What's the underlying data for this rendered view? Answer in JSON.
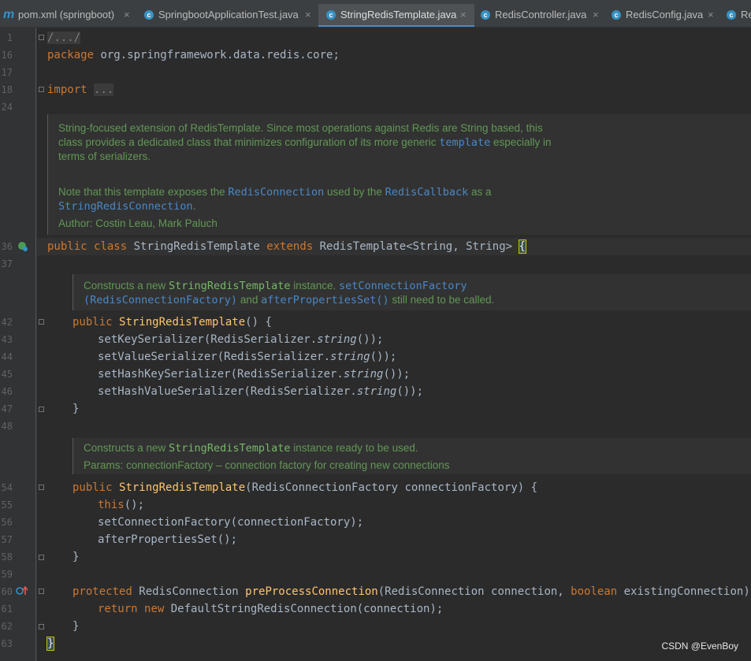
{
  "tabs": [
    {
      "label": "pom.xml (springboot)",
      "icon": "m-maven-icon",
      "active": false
    },
    {
      "label": "SpringbootApplicationTest.java",
      "icon": "class-icon",
      "active": false
    },
    {
      "label": "StringRedisTemplate.java",
      "icon": "class-icon",
      "active": true
    },
    {
      "label": "RedisController.java",
      "icon": "class-icon",
      "active": false
    },
    {
      "label": "RedisConfig.java",
      "icon": "class-icon",
      "active": false
    },
    {
      "label": "Re",
      "icon": "class-icon",
      "active": false
    }
  ],
  "tab_close_glyph": "×",
  "line_numbers": [
    "1",
    "16",
    "17",
    "18",
    "24",
    "36",
    "37",
    "42",
    "43",
    "44",
    "45",
    "46",
    "47",
    "48",
    "54",
    "55",
    "56",
    "57",
    "58",
    "59",
    "60",
    "61",
    "62",
    "63"
  ],
  "code": {
    "l1": "/.../",
    "package_kw": "package",
    "package_name": " org.springframework.data.redis.core;",
    "import_kw": "import",
    "import_fold": "...",
    "class_public": "public",
    "class_class": "class",
    "class_name": " StringRedisTemplate ",
    "class_extends": "extends",
    "class_super": " RedisTemplate<String, String> ",
    "brace_open": "{",
    "ctor1_public": "public",
    "ctor1_name": "StringRedisTemplate",
    "ctor1_rest": "() {",
    "set_key": "setKeySerializer(RedisSerializer.",
    "set_value": "setValueSerializer(RedisSerializer.",
    "set_hash_key": "setHashKeySerializer(RedisSerializer.",
    "set_hash_value": "setHashValueSerializer(RedisSerializer.",
    "string_call": "string",
    "call_end": "());",
    "close_brace": "}",
    "ctor2_public": "public",
    "ctor2_name": "StringRedisTemplate",
    "ctor2_rest": "(RedisConnectionFactory connectionFactory) {",
    "this_call": "this",
    "this_end": "();",
    "set_conn_factory": "setConnectionFactory(connectionFactory);",
    "after_props": "afterPropertiesSet();",
    "pre_protected": "protected",
    "pre_type": " RedisConnection ",
    "pre_name": "preProcessConnection",
    "pre_args1": "(RedisConnection connection, ",
    "pre_boolean": "boolean",
    "pre_args2": " existingConnection) {",
    "ret_return": "return",
    "ret_new": "new",
    "ret_rest": " DefaultStringRedisConnection(connection);",
    "final_brace": "}"
  },
  "docs": {
    "class_doc": {
      "p1_l1": "String-focused extension of RedisTemplate. Since most operations against Redis are String based, this",
      "p1_l2a": "class provides a dedicated class that minimizes configuration of its more generic ",
      "p1_l2_ref": "template",
      "p1_l2b": " especially in",
      "p1_l3": "terms of serializers.",
      "p2_l1a": "Note that this template exposes the ",
      "p2_ref1": "RedisConnection",
      "p2_l1b": " used by the ",
      "p2_ref2": "RedisCallback",
      "p2_l1c": " as a",
      "p2_ref3": "StringRedisConnection",
      "p2_l2_end": ".",
      "author": "Author: Costin Leau, Mark Paluch"
    },
    "ctor1_doc": {
      "l1a": "Constructs a new ",
      "l1_code": "StringRedisTemplate",
      "l1b": " instance. ",
      "l1_ref": "setConnectionFactory",
      "l2_ref": "(RedisConnectionFactory)",
      "l2a": " and ",
      "l2_ref2": "afterPropertiesSet()",
      "l2b": " still need to be called."
    },
    "ctor2_doc": {
      "l1a": "Constructs a new ",
      "l1_code": "StringRedisTemplate",
      "l1b": " instance ready to be used.",
      "l2": "Params: connectionFactory – connection factory for creating new connections"
    }
  },
  "watermark": "CSDN @EvenBoy",
  "colors": {
    "keyword": "#cc7832",
    "method": "#ffc66d",
    "doc": "#629755",
    "link": "#4a88c7",
    "text": "#a9b7c6",
    "background": "#2b2b2b"
  }
}
